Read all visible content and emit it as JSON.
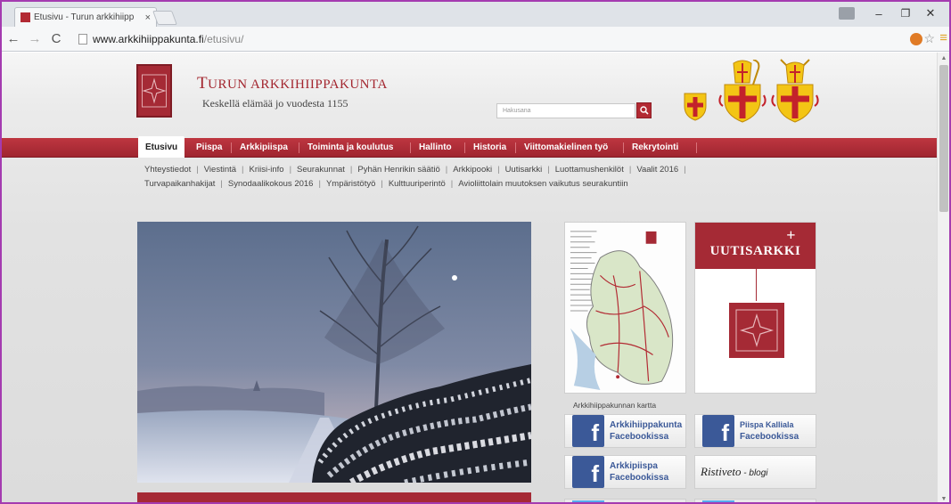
{
  "browser": {
    "tab_title": "Etusivu - Turun arkkihiipp",
    "tab_close": "×",
    "url_host": "www.arkkihiippakunta.fi",
    "url_path": "/etusivu/",
    "controls": {
      "minimize": "–",
      "maximize": "❐",
      "close": "✕"
    }
  },
  "site": {
    "title_first": "T",
    "title_rest": "URUN ARKKIHIIPPAKUNTA",
    "subtitle": "Keskellä elämää jo vuodesta 1155",
    "search_placeholder": "Hakusana",
    "accent_color": "#a52a35"
  },
  "main_nav": [
    {
      "label": "Etusivu",
      "active": true
    },
    {
      "label": "Piispa"
    },
    {
      "label": "Arkkipiispa"
    },
    {
      "label": "Toiminta ja koulutus"
    },
    {
      "label": "Hallinto"
    },
    {
      "label": "Historia"
    },
    {
      "label": "Viittomakielinen työ"
    },
    {
      "label": "Rekrytointi"
    }
  ],
  "sub_nav": {
    "row1": [
      "Yhteystiedot",
      "Viestintä",
      "Kriisi-info",
      "Seurakunnat",
      "Pyhän Henrikin säätiö",
      "Arkkipooki",
      "Uutisarkki",
      "Luottamushenkilöt",
      "Vaalit 2016"
    ],
    "row2": [
      "Turvapaikanhakijat",
      "Synodaalikokous 2016",
      "Ympäristötyö",
      "Kulttuuriperintö",
      "Avioliittolain muutoksen vaikutus seurakuntiin"
    ],
    "separator": "|"
  },
  "sidebar": {
    "map_caption": "Arkkihiippakunnan kartta",
    "uutisarkki_title": "UUTISARKKI",
    "uutisarkki_plus": "+",
    "fb1_line1": "Arkkihiippakunta",
    "fb1_line2": "Facebookissa",
    "fb2_line1": "Piispa Kalliala",
    "fb2_line2": "Facebookissa",
    "fb3_line1": "Arkkipiispa",
    "fb3_line2": "Facebookissa",
    "blog_name": "Ristiveto",
    "blog_suffix": " - blogi",
    "fb_letter": "f"
  }
}
